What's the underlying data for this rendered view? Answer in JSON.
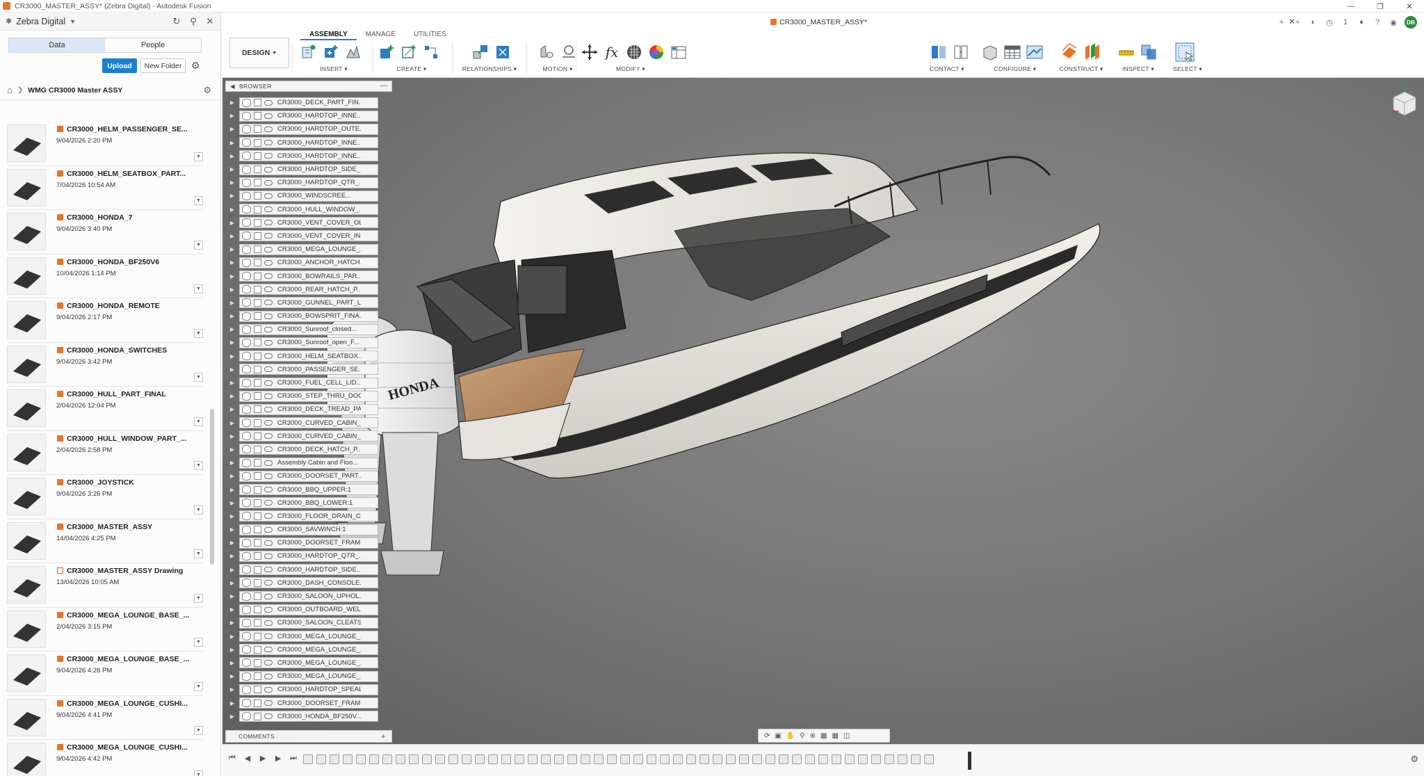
{
  "window": {
    "title": "CR3000_MASTER_ASSY* (Zebra Digital) - Autodesk Fusion"
  },
  "data_panel": {
    "team": "Zebra Digital",
    "tabs": [
      "Data",
      "People"
    ],
    "upload_label": "Upload",
    "new_folder_label": "New Folder",
    "project": "WMG CR3000 Master ASSY",
    "files": [
      {
        "name": "CR3000_HELM_PASSENGER_SE...",
        "date": "9/04/2026 2:20 PM",
        "type": "part"
      },
      {
        "name": "CR3000_HELM_SEATBOX_PART...",
        "date": "7/04/2026 10:54 AM",
        "type": "part"
      },
      {
        "name": "CR3000_HONDA_7",
        "date": "9/04/2026 3:40 PM",
        "type": "part"
      },
      {
        "name": "CR3000_HONDA_BF250V6",
        "date": "10/04/2026 1:14 PM",
        "type": "part"
      },
      {
        "name": "CR3000_HONDA_REMOTE",
        "date": "9/04/2026 2:17 PM",
        "type": "part"
      },
      {
        "name": "CR3000_HONDA_SWITCHES",
        "date": "9/04/2026 3:42 PM",
        "type": "part"
      },
      {
        "name": "CR3000_HULL_PART_FINAL",
        "date": "2/04/2026 12:04 PM",
        "type": "part"
      },
      {
        "name": "CR3000_HULL_WINDOW_PART_...",
        "date": "2/04/2026 2:58 PM",
        "type": "part"
      },
      {
        "name": "CR3000_JOYSTICK",
        "date": "9/04/2026 3:26 PM",
        "type": "part"
      },
      {
        "name": "CR3000_MASTER_ASSY",
        "date": "14/04/2026 4:25 PM",
        "type": "part"
      },
      {
        "name": "CR3000_MASTER_ASSY Drawing",
        "date": "13/04/2026 10:05 AM",
        "type": "drawing"
      },
      {
        "name": "CR3000_MEGA_LOUNGE_BASE_...",
        "date": "2/04/2026 3:15 PM",
        "type": "part"
      },
      {
        "name": "CR3000_MEGA_LOUNGE_BASE_...",
        "date": "9/04/2026 4:26 PM",
        "type": "part"
      },
      {
        "name": "CR3000_MEGA_LOUNGE_CUSHI...",
        "date": "9/04/2026 4:41 PM",
        "type": "part"
      },
      {
        "name": "CR3000_MEGA_LOUNGE_CUSHI...",
        "date": "9/04/2026 4:42 PM",
        "type": "part"
      }
    ]
  },
  "ribbon": {
    "document_title": "CR3000_MASTER_ASSY*",
    "workspace_tabs": [
      "ASSEMBLY",
      "MANAGE",
      "UTILITIES"
    ],
    "design_label": "DESIGN",
    "groups": [
      {
        "label": "INSERT"
      },
      {
        "label": "CREATE"
      },
      {
        "label": "RELATIONSHIPS"
      },
      {
        "label": "MOTION"
      },
      {
        "label": "MODIFY"
      },
      {
        "label": "CONTACT"
      },
      {
        "label": "CONFIGURE"
      },
      {
        "label": "CONSTRUCT"
      },
      {
        "label": "INSPECT"
      },
      {
        "label": "SELECT"
      }
    ],
    "notification_count": "1",
    "user_initials": "DB"
  },
  "browser": {
    "title": "BROWSER",
    "items": [
      "CR3000_DECK_PART_FIN...",
      "CR3000_HARDTOP_INNE...",
      "CR3000_HARDTOP_OUTE...",
      "CR3000_HARDTOP_INNE...",
      "CR3000_HARDTOP_INNE...",
      "CR3000_HARDTOP_SIDE_...",
      "CR3000_HARDTOP_QTR_...",
      "CR3000_WINDSCREE...",
      "CR3000_HULL_WINDOW_...",
      "CR3000_VENT_COVER_OL...",
      "CR3000_VENT_COVER_IN...",
      "CR3000_MEGA_LOUNGE_...",
      "CR3000_ANCHOR_HATCH...",
      "CR3000_BOWRAILS_PAR...",
      "CR3000_REAR_HATCH_P...",
      "CR3000_GUNNEL_PART_L...",
      "CR3000_BOWSPRIT_FINA...",
      "CR3000_Sunroof_closed...",
      "CR3000_Sunroof_open_F...",
      "CR3000_HELM_SEATBOX...",
      "CR3000_PASSENGER_SE...",
      "CR3000_FUEL_CELL_LID...",
      "CR3000_STEP_THRU_DOO...",
      "CR3000_DECK_TREAD_PA...",
      "CR3000_CURVED_CABIN_...",
      "CR3000_CURVED_CABIN_...",
      "CR3000_DECK_HATCH_P...",
      "Assembly Cabin and Floo...",
      "CR3000_DOORSET_PART...",
      "CR3000_BBQ_UPPER:1",
      "CR3000_BBQ_LOWER:1",
      "CR3000_FLOOR_DRAIN_C...",
      "CR3000_SAVWINCH:1",
      "CR3000_DOORSET_FRAM...",
      "CR3000_HARDTOP_QTR_...",
      "CR3000_HARDTOP_SIDE...",
      "CR3000_DASH_CONSOLE...",
      "CR3000_SALOON_UPHOL...",
      "CR3000_OUTBOARD_WEL...",
      "CR3000_SALOON_CLEATS...",
      "CR3000_MEGA_LOUNGE_...",
      "CR3000_MEGA_LOUNGE_...",
      "CR3000_MEGA_LOUNGE_...",
      "CR3000_MEGA_LOUNGE_...",
      "CR3000_HARDTOP_SPEAL...",
      "CR3000_DOORSET_FRAM...",
      "CR3000_HONDA_BF250V..."
    ]
  },
  "comments": {
    "title": "COMMENTS"
  },
  "model": {
    "brand_text": "HONDA"
  }
}
